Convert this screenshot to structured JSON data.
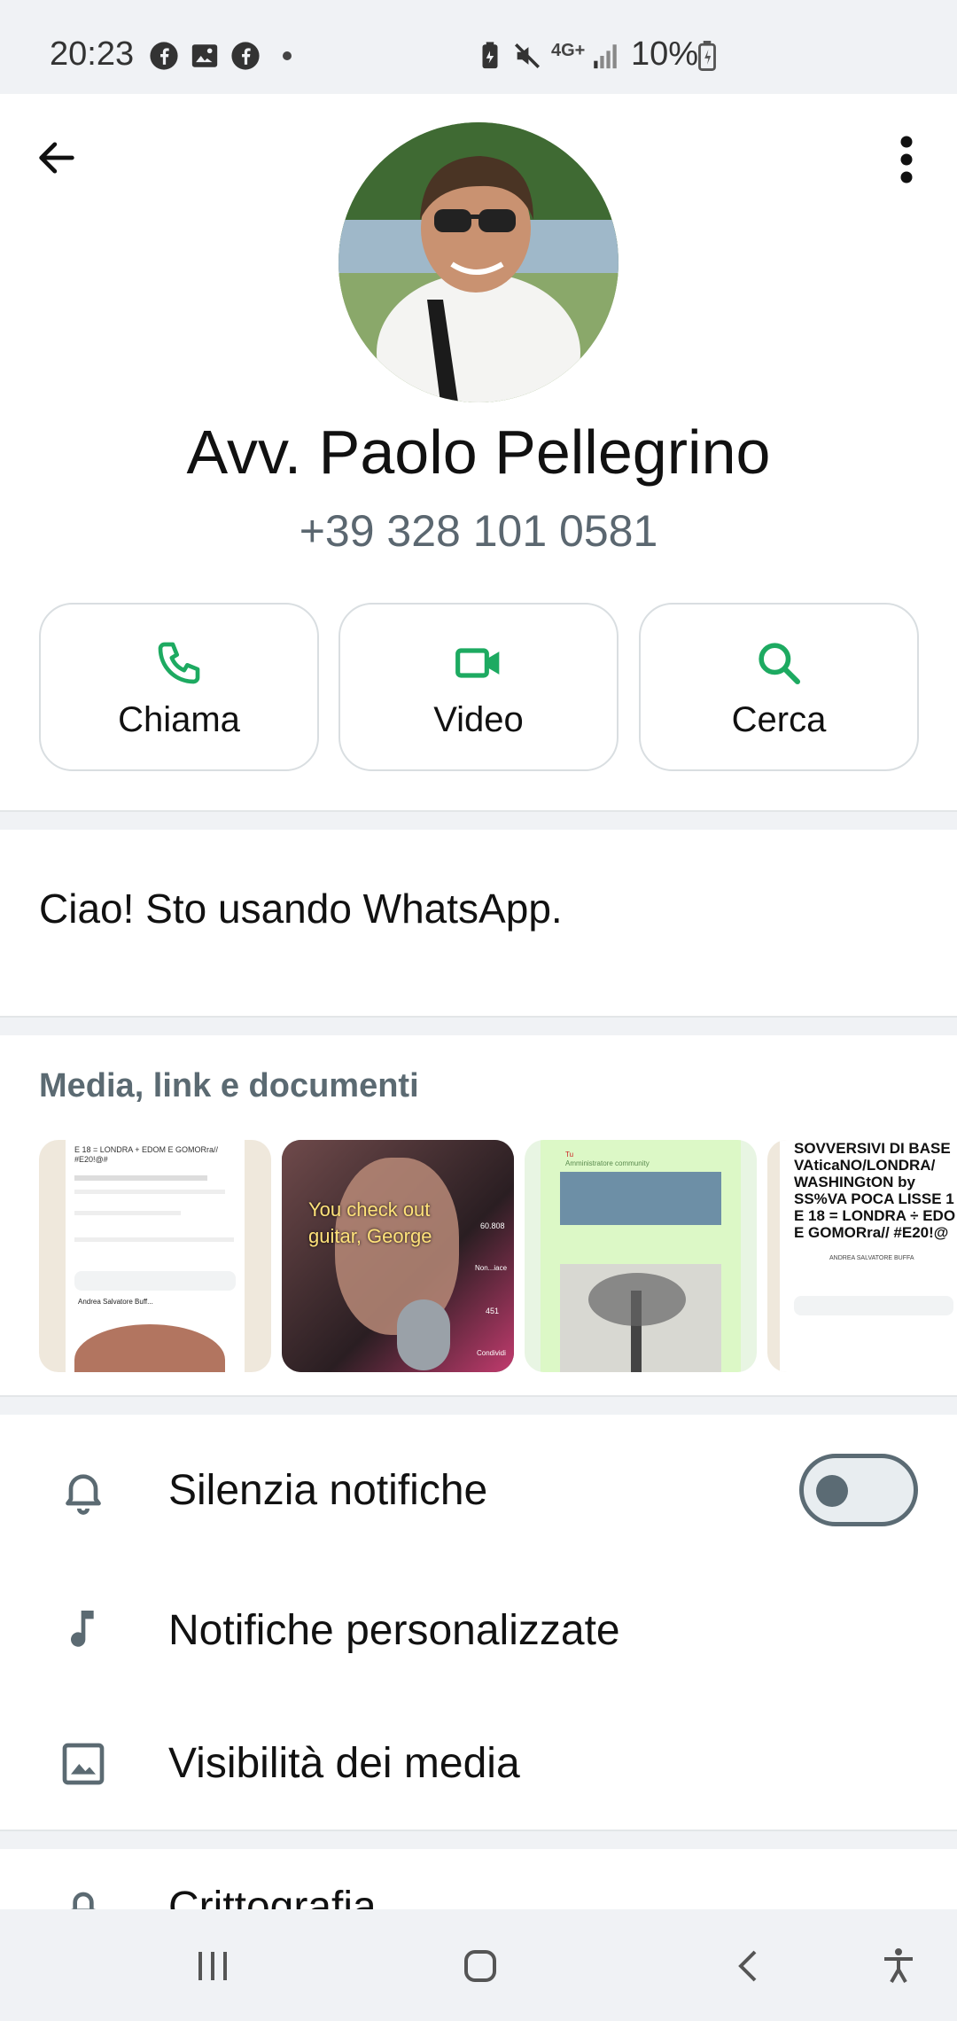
{
  "status_bar": {
    "time": "20:23",
    "battery": "10%",
    "network": "4G+"
  },
  "header": {
    "back_icon": "arrow-left-icon",
    "menu_icon": "more-vertical-icon"
  },
  "contact": {
    "name": "Avv. Paolo Pellegrino",
    "phone": "+39 328 101 0581"
  },
  "actions": [
    {
      "label": "Chiama",
      "icon": "phone-icon"
    },
    {
      "label": "Video",
      "icon": "video-camera-icon"
    },
    {
      "label": "Cerca",
      "icon": "search-icon"
    }
  ],
  "about": {
    "text": "Ciao! Sto usando WhatsApp."
  },
  "media": {
    "title": "Media, link e documenti",
    "thumbs": [
      {
        "caption_lines": [
          "E 18 = LONDRA + EDOM E GOMORra// #E20!@#"
        ],
        "footer": "Andrea Salvatore Buff..."
      },
      {
        "caption_lines": [
          "You check out",
          "guitar, George"
        ],
        "stats": [
          "60.808",
          "Non...iace",
          "451",
          "Condividi"
        ]
      },
      {
        "caption_lines": [
          "Tu",
          "Amministratore community"
        ]
      },
      {
        "caption_lines": [
          "SOVVERSIVI DI BASE",
          "VAticaNO/LONDRA/",
          "WASHINGtON by",
          "SS%VA POCA LISSE 1",
          "E 18 = LONDRA ÷ EDO",
          "E GOMORra// #E20!@"
        ],
        "footer": "ANDREA SALVATORE BUFFA"
      }
    ]
  },
  "settings": [
    {
      "label": "Silenzia notifiche",
      "icon": "bell-icon",
      "toggle": false
    },
    {
      "label": "Notifiche personalizzate",
      "icon": "music-note-icon"
    },
    {
      "label": "Visibilità dei media",
      "icon": "image-icon"
    },
    {
      "label": "Crittografia",
      "icon": "lock-icon"
    }
  ],
  "colors": {
    "accent": "#1daa61",
    "background_gray": "#f0f2f5",
    "muted_text": "#5b6a72"
  }
}
